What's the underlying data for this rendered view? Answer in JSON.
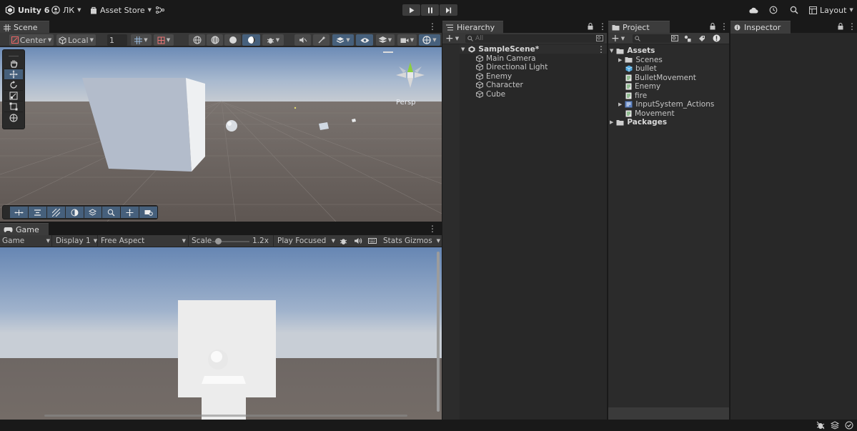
{
  "app": {
    "title": "Unity 6",
    "account": "ЛК",
    "store": "Asset Store",
    "layout": "Layout"
  },
  "scene": {
    "tab": "Scene",
    "pivot": "Center",
    "space": "Local",
    "grid_value": "1",
    "persp": "Persp"
  },
  "game": {
    "tab": "Game",
    "mode": "Game",
    "display": "Display 1",
    "aspect": "Free Aspect",
    "scale_label": "Scale",
    "scale_value": "1.2x",
    "play_focus": "Play Focused",
    "stats": "Stats",
    "gizmos": "Gizmos"
  },
  "hierarchy": {
    "tab": "Hierarchy",
    "search_placeholder": "All",
    "scene_name": "SampleScene*",
    "items": [
      "Main Camera",
      "Directional Light",
      "Enemy",
      "Character",
      "Cube"
    ]
  },
  "project": {
    "tab": "Project",
    "root": "Assets",
    "items": [
      "Scenes",
      "bullet",
      "BulletMovement",
      "Enemy",
      "fire",
      "InputSystem_Actions",
      "Movement"
    ],
    "packages": "Packages"
  },
  "inspector": {
    "tab": "Inspector"
  },
  "colors": {
    "accent_selected": "#46607c",
    "panel_bg": "#282828",
    "toolbar_bg": "#383838",
    "chrome_bg": "#191919"
  }
}
